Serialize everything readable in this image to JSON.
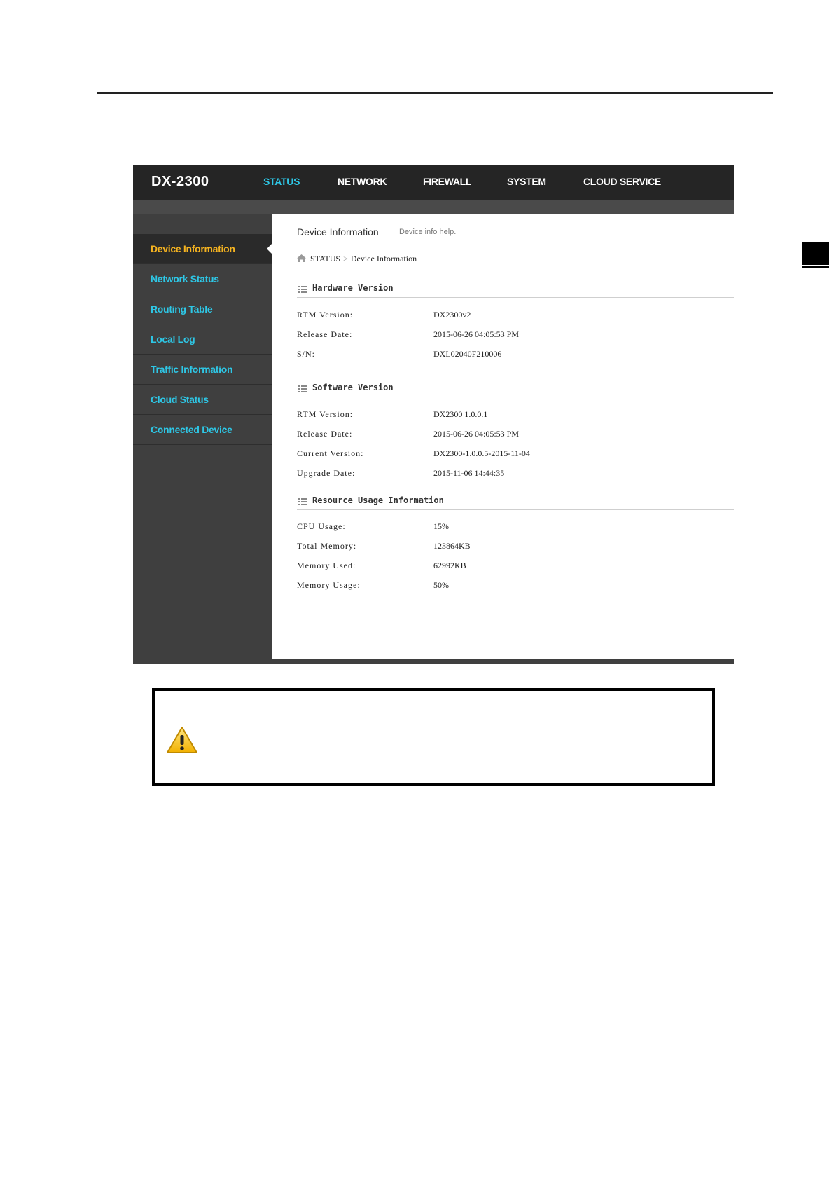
{
  "ui": {
    "brand": "DX-2300",
    "nav": [
      "STATUS",
      "NETWORK",
      "FIREWALL",
      "SYSTEM",
      "CLOUD SERVICE"
    ],
    "sidebar": [
      "Device Information",
      "Network Status",
      "Routing Table",
      "Local Log",
      "Traffic Information",
      "Cloud Status",
      "Connected Device"
    ],
    "page_title": "Device Information",
    "page_help": "Device info help.",
    "breadcrumb": {
      "root": "STATUS",
      "sep": ">",
      "current": "Device Information"
    },
    "sections": {
      "hardware": {
        "title": "Hardware Version",
        "rows": [
          {
            "label": "RTM Version:",
            "value": "DX2300v2"
          },
          {
            "label": "Release Date:",
            "value": "2015-06-26 04:05:53 PM"
          },
          {
            "label": "S/N:",
            "value": "DXL02040F210006"
          }
        ]
      },
      "software": {
        "title": "Software Version",
        "rows": [
          {
            "label": "RTM Version:",
            "value": "DX2300 1.0.0.1"
          },
          {
            "label": "Release Date:",
            "value": "2015-06-26 04:05:53 PM"
          },
          {
            "label": "Current Version:",
            "value": "DX2300-1.0.0.5-2015-11-04"
          },
          {
            "label": "Upgrade Date:",
            "value": "2015-11-06 14:44:35"
          }
        ]
      },
      "resource": {
        "title": "Resource Usage Information",
        "rows": [
          {
            "label": "CPU Usage:",
            "value": "15%"
          },
          {
            "label": "Total Memory:",
            "value": "123864KB"
          },
          {
            "label": "Memory Used:",
            "value": "62992KB"
          },
          {
            "label": "Memory Usage:",
            "value": "50%"
          }
        ]
      }
    }
  },
  "colors": {
    "accent": "#2ec7e6",
    "active": "#f5b320",
    "topbar": "#252525",
    "sidebar": "#3f3f3f"
  },
  "icons": {
    "home": "home-icon",
    "section": "list-icon",
    "warning": "warning-icon"
  }
}
